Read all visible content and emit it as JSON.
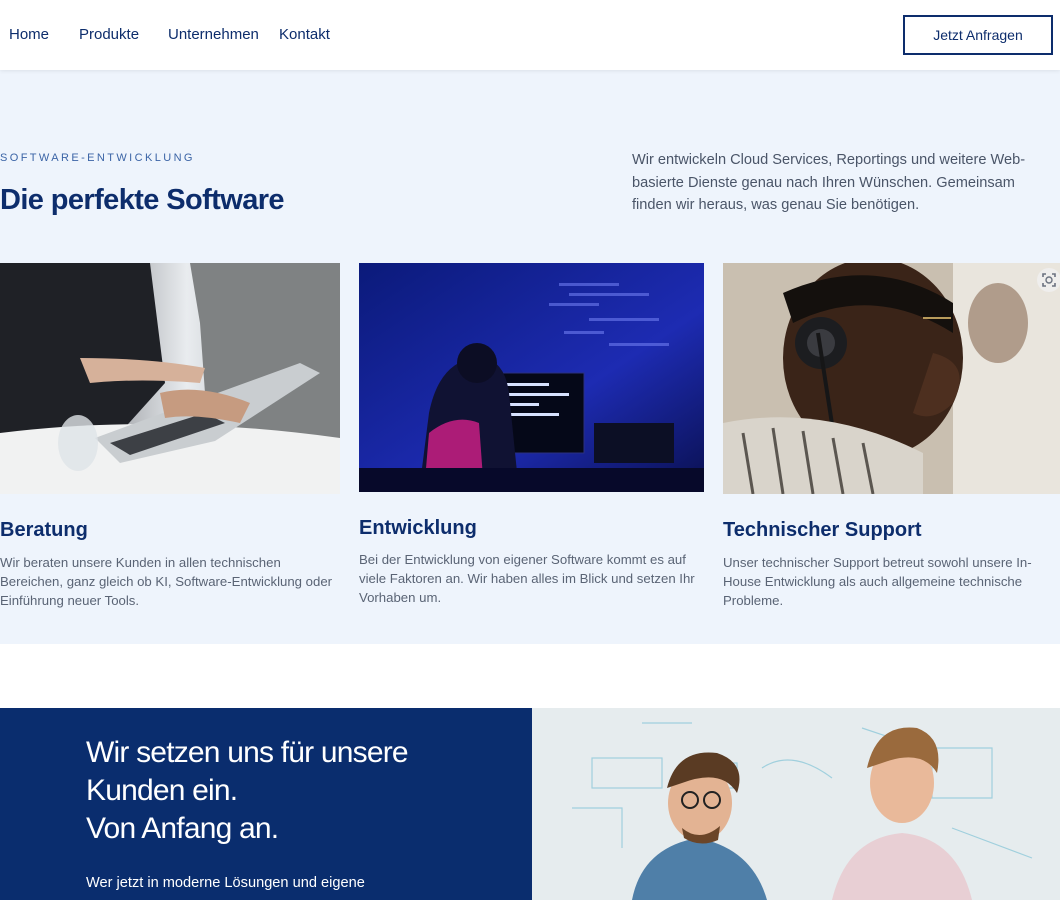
{
  "nav": {
    "items": [
      "Home",
      "Produkte",
      "Unternehmen",
      "Kontakt"
    ],
    "cta": "Jetzt Anfragen"
  },
  "software": {
    "eyebrow": "SOFTWARE-ENTWICKLUNG",
    "title": "Die perfekte Software",
    "intro": "Wir entwickeln Cloud Services, Reportings und weitere Web-basierte Dienste genau nach Ihren Wünschen. Gemeinsam finden wir heraus, was genau Sie benötigen."
  },
  "cards": [
    {
      "title": "Beratung",
      "text": "Wir beraten unsere Kunden in allen technischen Bereichen, ganz gleich ob KI, Software-Entwicklung oder Einführung neuer Tools."
    },
    {
      "title": "Entwicklung",
      "text": "Bei der Entwicklung von eigener Software kommt es auf viele Faktoren an. Wir haben alles im Blick und setzen Ihr Vorhaben um."
    },
    {
      "title": "Technischer Support",
      "text": "Unser technischer Support betreut sowohl unsere In-House Entwicklung als auch allgemeine technische Probleme."
    }
  ],
  "commitment": {
    "headline_1": "Wir setzen uns für unsere",
    "headline_2": "Kunden ein.",
    "headline_3": "Von Anfang an.",
    "subline": "Wer jetzt in moderne Lösungen und eigene"
  },
  "colors": {
    "brand": "#0a2d6e",
    "section_bg": "#eef4fc",
    "text": "#4a5568"
  },
  "icons": [
    "image-scan-icon"
  ]
}
